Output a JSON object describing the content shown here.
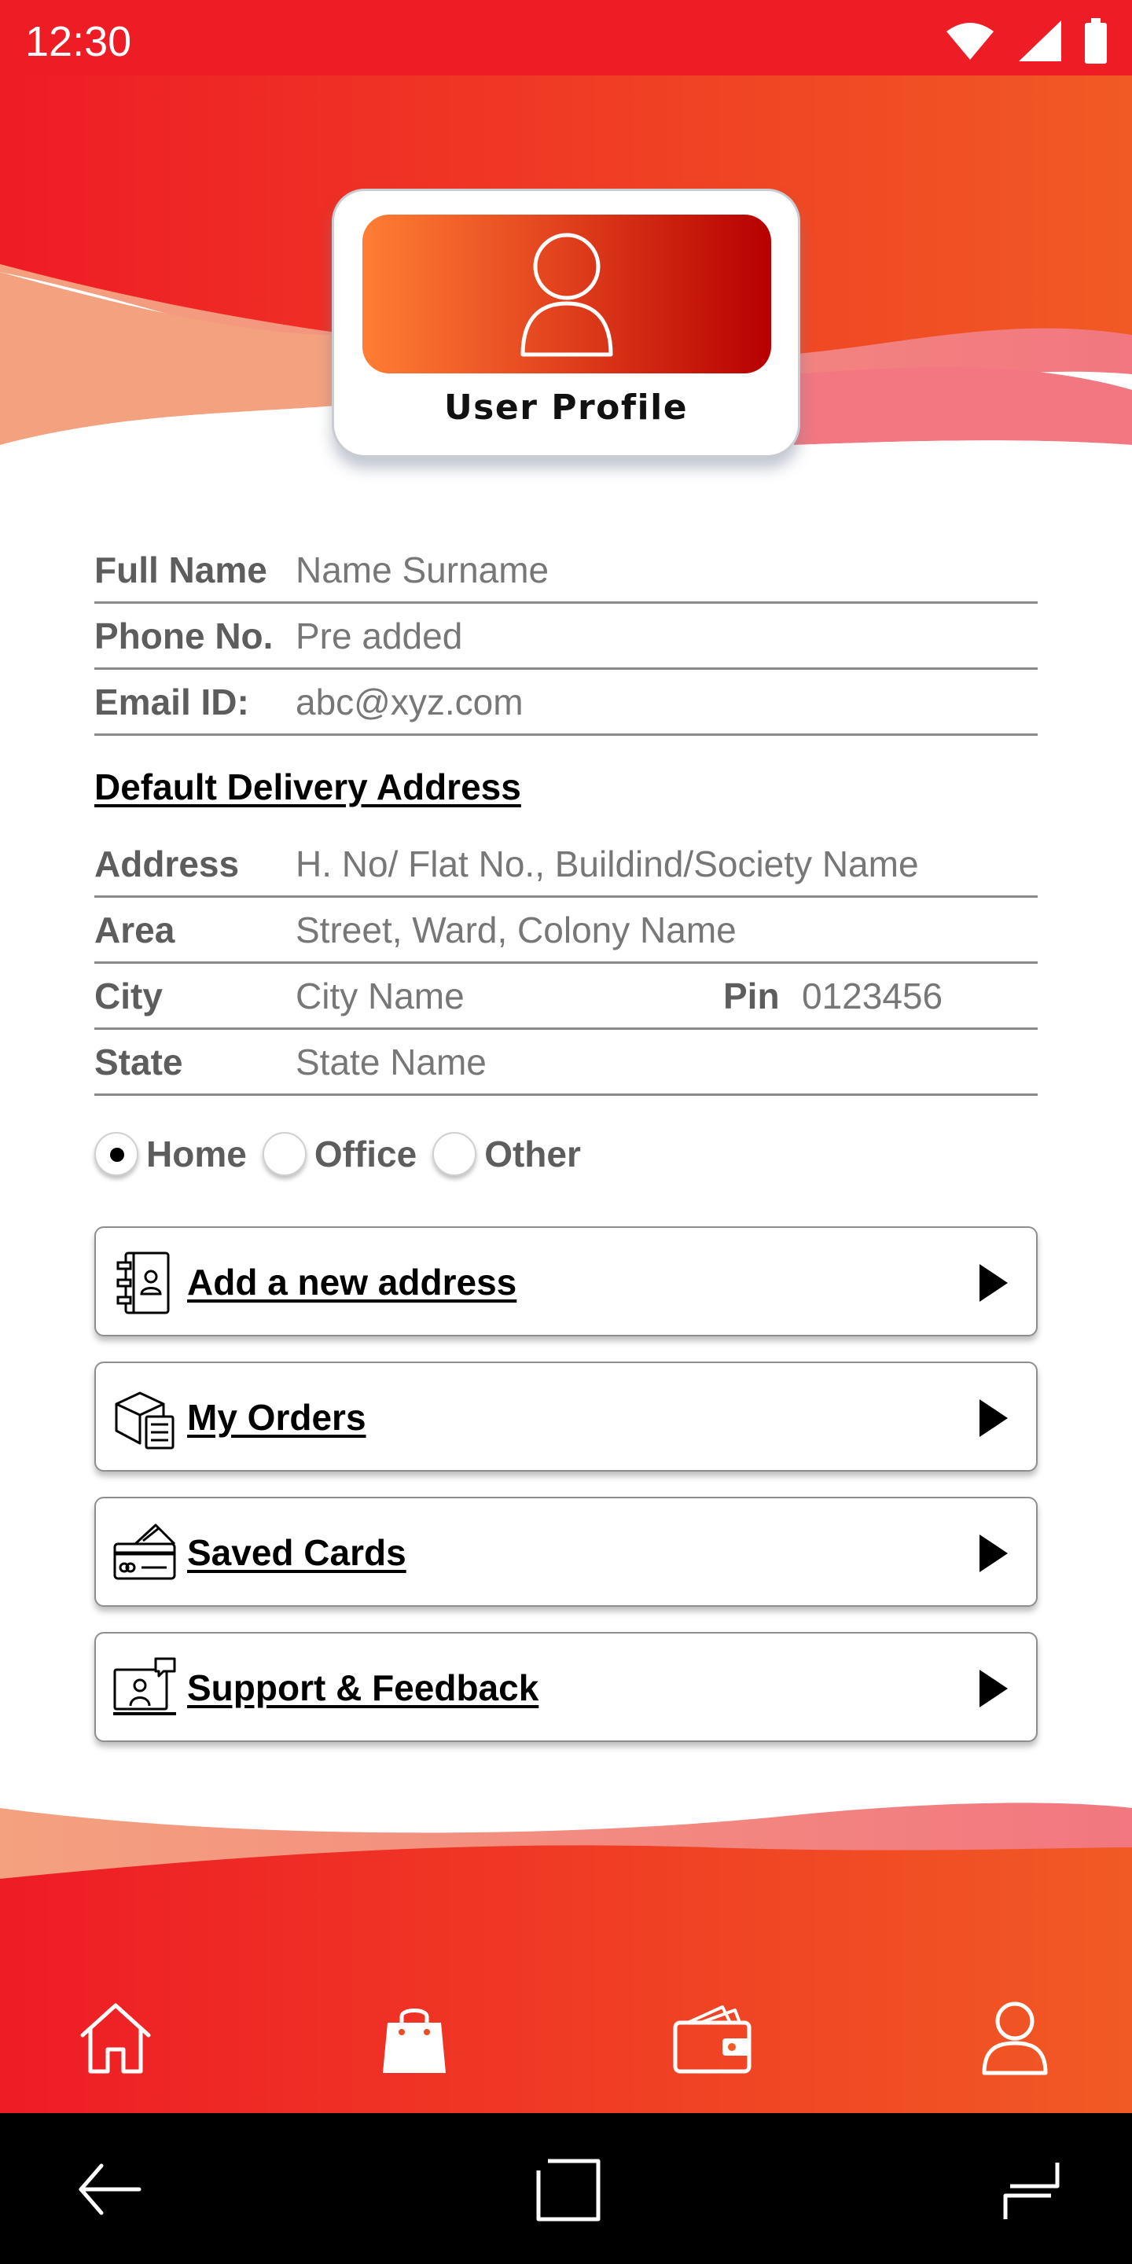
{
  "status_bar": {
    "time": "12:30"
  },
  "profile": {
    "title": "User Profile"
  },
  "personal": [
    {
      "label": "Full Name",
      "value": "Name Surname"
    },
    {
      "label": "Phone No.",
      "value": "Pre added"
    },
    {
      "label": "Email ID:",
      "value": "abc@xyz.com"
    }
  ],
  "address_section": {
    "title": "Default Delivery Address",
    "address": {
      "label": "Address",
      "value": "H. No/ Flat No., Buildind/Society Name"
    },
    "area": {
      "label": "Area",
      "value": "Street, Ward, Colony Name"
    },
    "city": {
      "label": "City",
      "value": "City Name"
    },
    "pin": {
      "label": "Pin",
      "value": "0123456"
    },
    "state": {
      "label": "State",
      "value": "State Name"
    }
  },
  "address_type": {
    "options": [
      "Home",
      "Office",
      "Other"
    ],
    "selected": "Home"
  },
  "menu": [
    {
      "label": "Add a new address",
      "icon": "address-book-icon"
    },
    {
      "label": "My Orders",
      "icon": "orders-box-icon"
    },
    {
      "label": "Saved Cards",
      "icon": "credit-card-icon"
    },
    {
      "label": "Support & Feedback",
      "icon": "support-chat-icon"
    }
  ],
  "bottom_nav": [
    "home-icon",
    "shopping-bag-icon",
    "wallet-icon",
    "user-icon"
  ],
  "colors": {
    "primary_red": "#ee1c25",
    "accent_orange": "#f15a24",
    "light_salmon": "#f4a17f"
  }
}
